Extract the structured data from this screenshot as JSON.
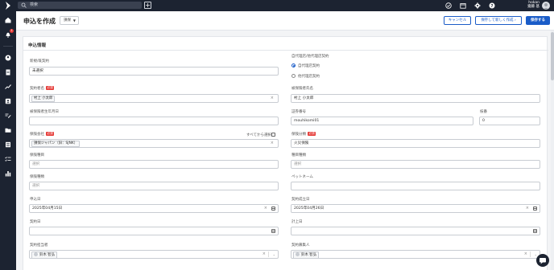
{
  "search": {
    "placeholder": "検索"
  },
  "user": {
    "company": "hokan",
    "name": "齋藤 基"
  },
  "header": {
    "title": "申込を作成",
    "type_select": "損保",
    "cancel_label": "キャンセル",
    "save_new_label": "保存して新しく作成",
    "save_label": "保存する"
  },
  "sidebar": {
    "notification_count": "1"
  },
  "form": {
    "section_title": "申込情報",
    "required_badge": "必須",
    "new_renewal": {
      "label": "新規/既契約",
      "value": "未選択"
    },
    "agency_type": {
      "label": "自代理店/他代理店契約",
      "options": [
        "自代理店契約",
        "他代理店契約"
      ],
      "selected": 0
    },
    "contractor_name": {
      "label": "契約者名",
      "value": "村上 小太郎"
    },
    "insured_name": {
      "label": "被保険者氏名",
      "value": "村上 小太郎"
    },
    "insured_birthday": {
      "label": "被保険者生年月日",
      "value": ""
    },
    "policy_number": {
      "label": "証券番号",
      "value": "mouhikomi01"
    },
    "branch_number": {
      "label": "枝番",
      "value": "0"
    },
    "insurance_company": {
      "label": "保険会社",
      "show_all_label": "すべてから選択",
      "value": "損保ジャパン（旧：SJNK）"
    },
    "insurance_category": {
      "label": "保険分類",
      "value": "火災保険"
    },
    "insurance_kind": {
      "label": "保険種目",
      "placeholder": "選択"
    },
    "kind_type": {
      "label": "種目種類",
      "placeholder": "選択"
    },
    "insurance_type": {
      "label": "保険種類",
      "placeholder": "選択"
    },
    "pet_name": {
      "label": "ペットネーム",
      "value": ""
    },
    "application_date": {
      "label": "申込日",
      "value": "2025年04月15日"
    },
    "contract_established": {
      "label": "契約成立日",
      "value": "2025年04月26日"
    },
    "contract_date": {
      "label": "契約日",
      "value": ""
    },
    "recorded_date": {
      "label": "計上日",
      "value": ""
    },
    "contract_person": {
      "label": "契約担当者",
      "value": "鈴木 智弘"
    },
    "contract_recruiter": {
      "label": "契約募集人",
      "value": "鈴木 智弘"
    }
  },
  "colors": {
    "accent": "#1a5cc8",
    "nav_bg": "#1c2331",
    "required": "#e53935"
  }
}
